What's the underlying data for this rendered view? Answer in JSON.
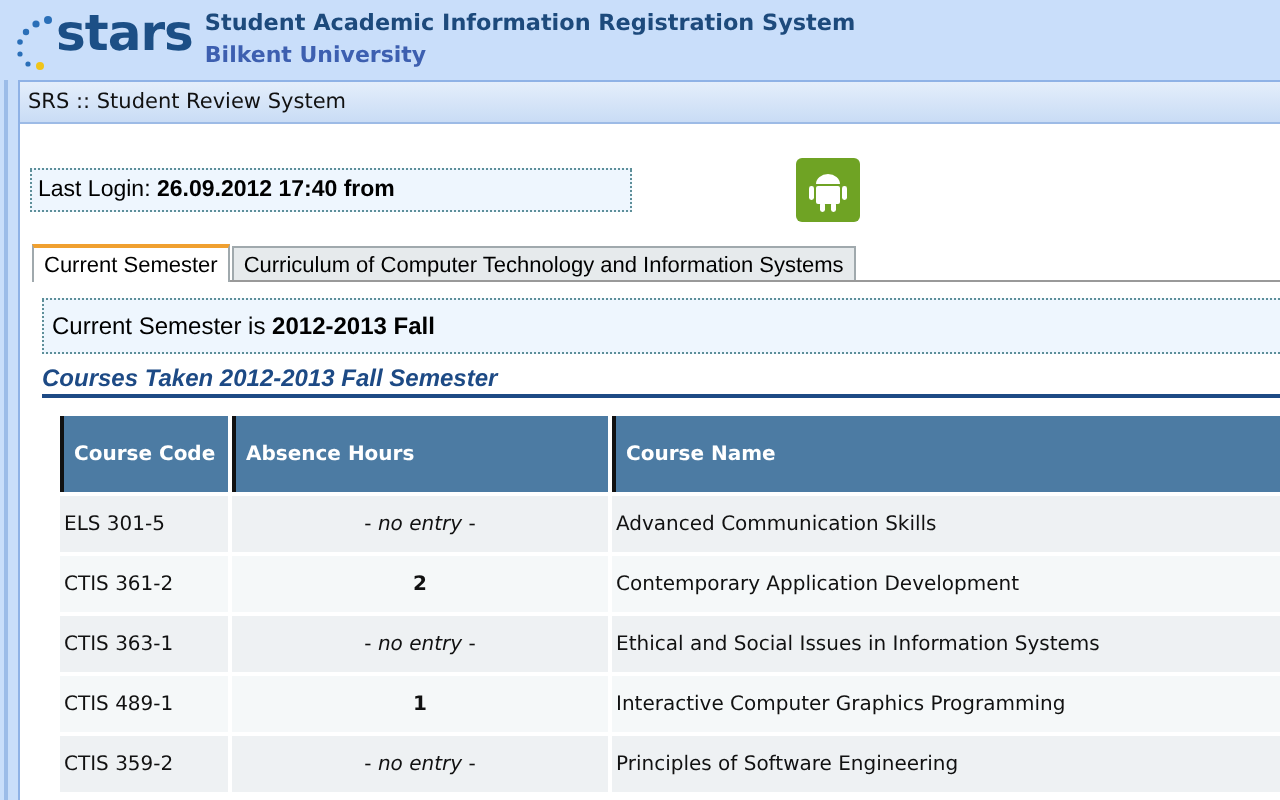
{
  "header": {
    "logo": "stars",
    "title": "Student Academic Information Registration System",
    "subtitle": "Bilkent University"
  },
  "panel": {
    "title": "SRS :: Student Review System"
  },
  "last_login": "Last Login: **26.09.2012 17:40 from**",
  "tabs": [
    {
      "label": "Current Semester",
      "selected": true
    },
    {
      "label": "Curriculum of Computer Technology and Information Systems",
      "selected": false
    }
  ],
  "current_semester": "Current Semester is **2012-2013 Fall**",
  "section_title": "Courses Taken 2012-2013 Fall Semester",
  "table": {
    "columns": [
      "Course Code",
      "Absence Hours",
      "Course Name"
    ],
    "rows": [
      {
        "code": "ELS 301-5",
        "absence": "- *no entry* -",
        "kind": "none",
        "name": "Advanced Communication Skills"
      },
      {
        "code": "CTIS 361-2",
        "absence": "2",
        "kind": "count",
        "name": "Contemporary Application Development"
      },
      {
        "code": "CTIS 363-1",
        "absence": "- *no entry* -",
        "kind": "none",
        "name": "Ethical and Social Issues in Information Systems"
      },
      {
        "code": "CTIS 489-1",
        "absence": "1",
        "kind": "count",
        "name": "Interactive Computer Graphics Programming"
      },
      {
        "code": "CTIS 359-2",
        "absence": "- *no entry* -",
        "kind": "none",
        "name": "Principles of Software Engineering"
      }
    ]
  }
}
